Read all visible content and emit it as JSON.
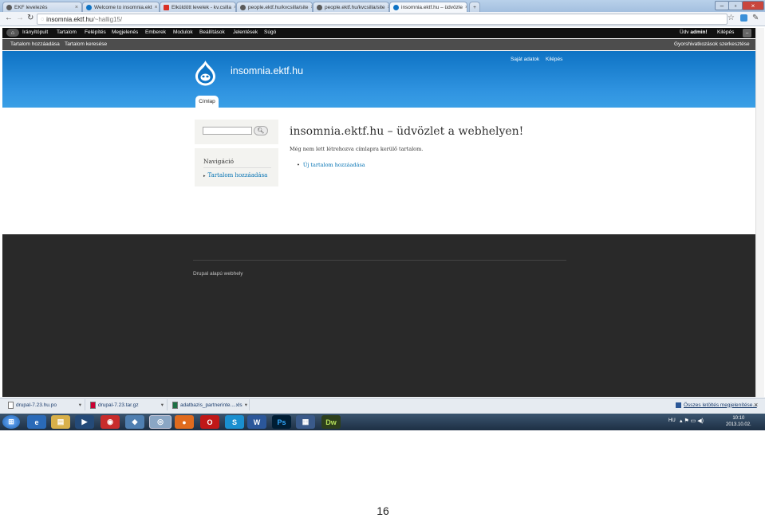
{
  "browser": {
    "tabs": [
      {
        "label": "EKF levelezés",
        "icon": "globe-icon",
        "color": "#5a5a5a"
      },
      {
        "label": "Welcome to insomnia.ekt",
        "icon": "drupal-icon",
        "color": "#0e73c4"
      },
      {
        "label": "Elküldött levelek - kv.csilla",
        "icon": "gmail-icon",
        "color": "#d93025"
      },
      {
        "label": "people.ektf.hu/kvcsilla/site",
        "icon": "globe-icon",
        "color": "#5a5a5a"
      },
      {
        "label": "people.ektf.hu/kvcsilla/site",
        "icon": "globe-icon",
        "color": "#5a5a5a"
      },
      {
        "label": "insomnia.ektf.hu – üdvözle",
        "icon": "drupal-icon",
        "color": "#0e73c4"
      }
    ],
    "url_host": "insomnia.ektf.hu",
    "url_path": "/~hallig15/"
  },
  "admin_menu": {
    "items": [
      "Irányítópult",
      "Tartalom",
      "Felépítés",
      "Megjelenés",
      "Emberek",
      "Modulok",
      "Beállítások",
      "Jelentések",
      "Súgó"
    ],
    "greeting": "Üdv",
    "user": "admin!",
    "logout": "Kilépés"
  },
  "shortcuts": {
    "items": [
      "Tartalom hozzáadása",
      "Tartalom keresése"
    ],
    "edit": "Gyorshivatkozások szerkesztése"
  },
  "header": {
    "site_name": "insomnia.ektf.hu",
    "secondary": [
      "Saját adatok",
      "Kilépés"
    ],
    "tab_home": "Címlap"
  },
  "sidebar": {
    "nav_title": "Navigáció",
    "nav_link": "Tartalom hozzáadása"
  },
  "main": {
    "title": "insomnia.ektf.hu – üdvözlet a webhelyen!",
    "text": "Még nem lett létrehozva címlapra kerülő tartalom.",
    "link": "Új tartalom hozzáadása"
  },
  "footer": {
    "text": "Drupal alapú webhely"
  },
  "downloads": {
    "items": [
      "drupal-7.23.hu.po",
      "drupal-7.23.tar.gz",
      "adatbazis_partnerinte....xls"
    ],
    "show_all": "Összes letöltés megjelenítése..."
  },
  "taskbar": {
    "lang": "HU",
    "time": "10:10",
    "date": "2013.10.02."
  },
  "page_number": "16",
  "colors": {
    "drupal_blue": "#0e73c4",
    "footer_bg": "#292929",
    "link": "#0071b3"
  }
}
